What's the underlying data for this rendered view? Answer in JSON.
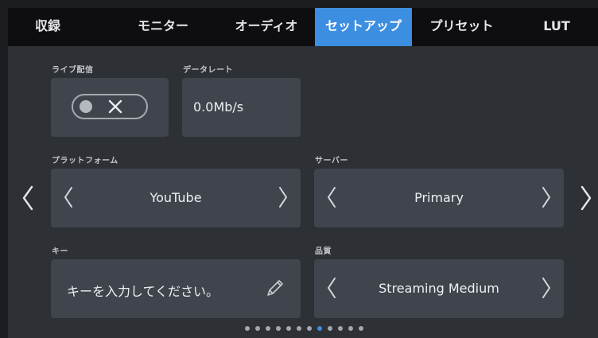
{
  "tabs": [
    {
      "label": "収録",
      "active": false
    },
    {
      "label": "モニター",
      "active": false
    },
    {
      "label": "オーディオ",
      "active": false
    },
    {
      "label": "セットアップ",
      "active": true
    },
    {
      "label": "プリセット",
      "active": false
    },
    {
      "label": "LUT",
      "active": false
    }
  ],
  "live_stream": {
    "label": "ライブ配信",
    "toggle_state": "off",
    "toggle_icon": "close-icon"
  },
  "data_rate": {
    "label": "データレート",
    "value": "0.0Mb/s"
  },
  "platform": {
    "label": "プラットフォーム",
    "value": "YouTube"
  },
  "server": {
    "label": "サーバー",
    "value": "Primary"
  },
  "key": {
    "label": "キー",
    "placeholder": "キーを入力してください。",
    "icon": "pencil-icon"
  },
  "quality": {
    "label": "品質",
    "value": "Streaming Medium"
  },
  "pagination": {
    "total": 12,
    "current": 8
  },
  "colors": {
    "accent": "#3b8ee0",
    "panel": "#40444c",
    "background": "#2d3035",
    "tabbar": "#0e0e10"
  }
}
